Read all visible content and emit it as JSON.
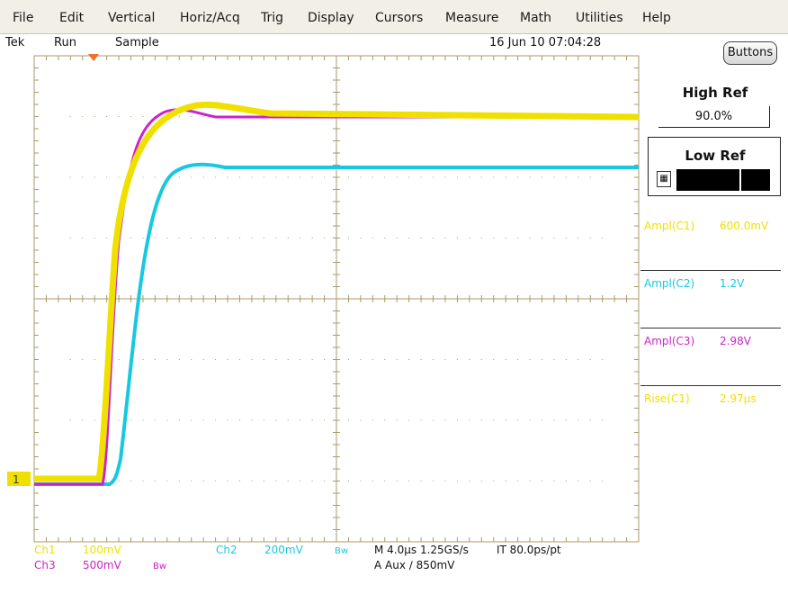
{
  "menu": [
    "File",
    "Edit",
    "Vertical",
    "Horiz/Acq",
    "Trig",
    "Display",
    "Cursors",
    "Measure",
    "Math",
    "Utilities",
    "Help"
  ],
  "status": {
    "brand": "Tek",
    "run_state": "Run",
    "acq_mode": "Sample",
    "datetime": "16 Jun 10 07:04:28"
  },
  "buttons_label": "Buttons",
  "panel": {
    "high_ref_title": "High Ref",
    "high_ref_value": "90.0%",
    "low_ref_title": "Low Ref"
  },
  "measurements": [
    {
      "label": "Ampl(C1)",
      "value": "600.0mV",
      "color": "#f0e000"
    },
    {
      "label": "Ampl(C2)",
      "value": "1.2V",
      "color": "#18c8e0"
    },
    {
      "label": "Ampl(C3)",
      "value": "2.98V",
      "color": "#cc22cc"
    },
    {
      "label": "Rise(C1)",
      "value": "2.97µs",
      "color": "#f0e000"
    }
  ],
  "channels": {
    "ch1": {
      "name": "Ch1",
      "scale": "100mV",
      "color": "#f0e000"
    },
    "ch2": {
      "name": "Ch2",
      "scale": "200mV",
      "bw": "Bw",
      "color": "#18c8e0"
    },
    "ch3": {
      "name": "Ch3",
      "scale": "500mV",
      "bw": "Bw",
      "color": "#cc22cc"
    }
  },
  "timebase": {
    "line1": "M 4.0µs 1.25GS/s",
    "it": "IT 80.0ps/pt",
    "line2": "A  Aux  ∕  850mV"
  },
  "ch1_marker": "1",
  "colors": {
    "grid": "#a89a6a",
    "menubar": "#f1efe6",
    "ch1": "#f0e000",
    "ch2": "#18c8e0",
    "ch3": "#cc22cc",
    "trigger": "#f07030"
  }
}
